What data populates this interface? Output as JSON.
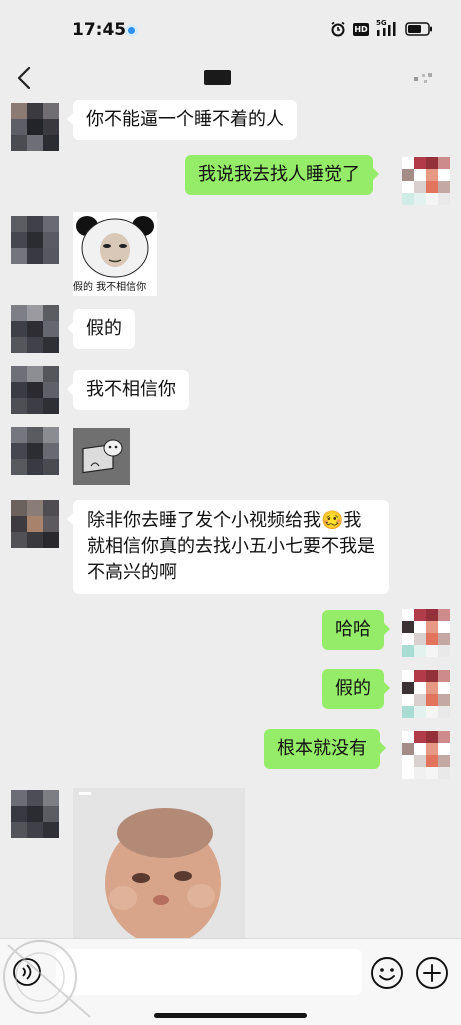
{
  "status_bar": {
    "time": "17:45",
    "network": "5G",
    "hd_label": "HD",
    "icons": [
      "alarm-icon",
      "hd-icon",
      "signal-icon",
      "battery-icon"
    ]
  },
  "header": {
    "title": "■■",
    "back_icon": "chevron-left-icon",
    "more_icon": "more-icon"
  },
  "messages": [
    {
      "side": "left",
      "type": "text",
      "text": "你不能逼一个睡不着的人"
    },
    {
      "side": "right",
      "type": "text",
      "text": "我说我去找人睡觉了"
    },
    {
      "side": "left",
      "type": "sticker",
      "caption": "假的  我不相信你"
    },
    {
      "side": "left",
      "type": "text",
      "text": "假的"
    },
    {
      "side": "left",
      "type": "text",
      "text": "我不相信你"
    },
    {
      "side": "left",
      "type": "sticker",
      "caption": ""
    },
    {
      "side": "left",
      "type": "text",
      "text": "除非你去睡了发个小视频给我🥴我就相信你真的去找小五小七要不我是不高兴的啊"
    },
    {
      "side": "right",
      "type": "text",
      "text": "哈哈"
    },
    {
      "side": "right",
      "type": "text",
      "text": "假的"
    },
    {
      "side": "right",
      "type": "text",
      "text": "根本就没有"
    },
    {
      "side": "left",
      "type": "image",
      "caption": ""
    }
  ],
  "input_bar": {
    "placeholder": "",
    "voice_icon": "voice-icon",
    "emoji_icon": "emoji-icon",
    "plus_icon": "plus-icon"
  },
  "colors": {
    "background": "#ededed",
    "incoming_bubble": "#ffffff",
    "outgoing_bubble": "#95ec69"
  }
}
